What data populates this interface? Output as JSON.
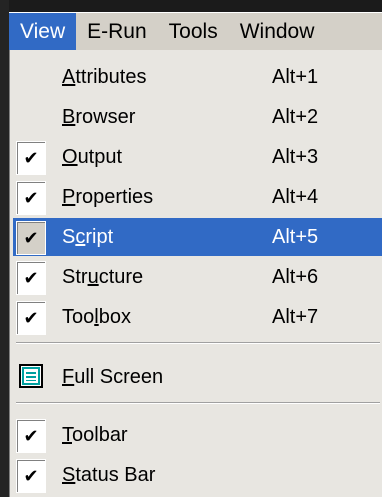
{
  "menubar": {
    "items": [
      {
        "label": "View",
        "active": true
      },
      {
        "label": "E-Run",
        "active": false
      },
      {
        "label": "Tools",
        "active": false
      },
      {
        "label": "Window",
        "active": false
      }
    ]
  },
  "menu": {
    "items": [
      {
        "id": "attributes",
        "pre": "",
        "acc": "A",
        "post": "ttributes",
        "shortcut": "Alt+1",
        "checked": false,
        "highlighted": false
      },
      {
        "id": "browser",
        "pre": "",
        "acc": "B",
        "post": "rowser",
        "shortcut": "Alt+2",
        "checked": false,
        "highlighted": false
      },
      {
        "id": "output",
        "pre": "",
        "acc": "O",
        "post": "utput",
        "shortcut": "Alt+3",
        "checked": true,
        "highlighted": false
      },
      {
        "id": "properties",
        "pre": "",
        "acc": "P",
        "post": "roperties",
        "shortcut": "Alt+4",
        "checked": true,
        "highlighted": false
      },
      {
        "id": "script",
        "pre": "S",
        "acc": "c",
        "post": "ript",
        "shortcut": "Alt+5",
        "checked": true,
        "highlighted": true
      },
      {
        "id": "structure",
        "pre": "Str",
        "acc": "u",
        "post": "cture",
        "shortcut": "Alt+6",
        "checked": true,
        "highlighted": false
      },
      {
        "id": "toolbox",
        "pre": "Too",
        "acc": "l",
        "post": "box",
        "shortcut": "Alt+7",
        "checked": true,
        "highlighted": false
      }
    ],
    "fullscreen": {
      "pre": "",
      "acc": "F",
      "post": "ull Screen",
      "icon": "fullscreen-window-icon"
    },
    "bottom_items": [
      {
        "id": "toolbar",
        "pre": "",
        "acc": "T",
        "post": "oolbar",
        "checked": true
      },
      {
        "id": "statusbar",
        "pre": "",
        "acc": "S",
        "post": "tatus Bar",
        "checked": true
      }
    ],
    "check_glyph": "✔"
  },
  "colors": {
    "highlight": "#316ac5",
    "menu_bg": "#e8e6e1",
    "menubar_bg": "#d4d0c8"
  }
}
